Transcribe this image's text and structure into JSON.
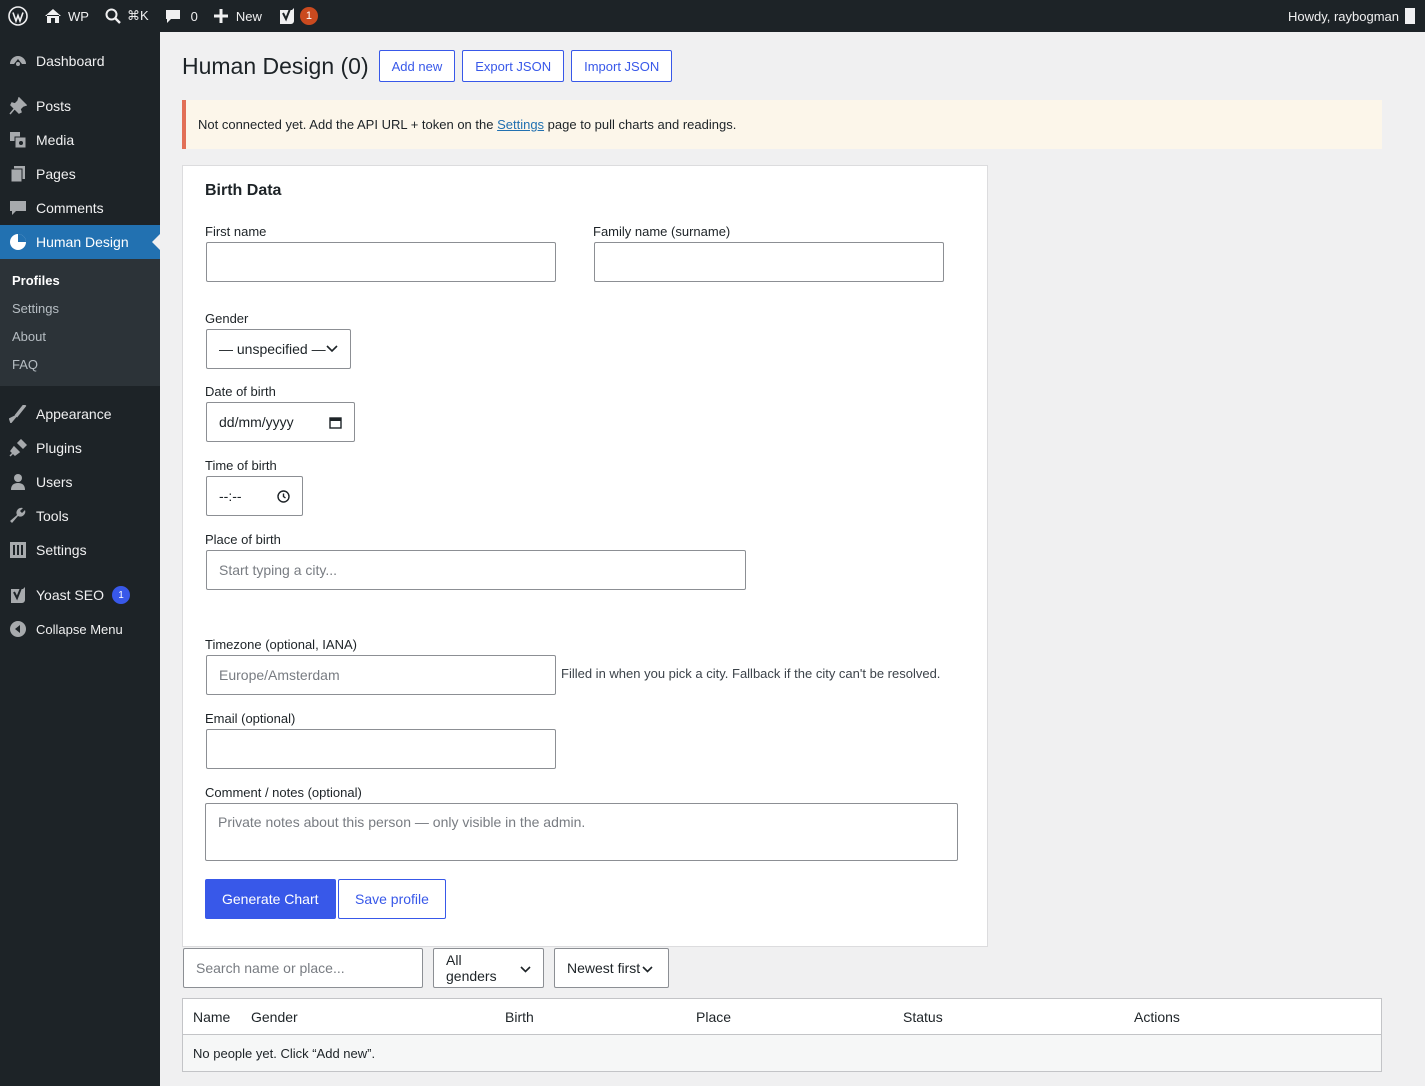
{
  "admin_bar": {
    "site_name": "WP",
    "search_shortcut": "⌘K",
    "comments_count": "0",
    "new_label": "New",
    "yoast_badge": "1",
    "greeting": "Howdy, raybogman"
  },
  "sidebar": {
    "items": [
      {
        "label": "Dashboard"
      },
      {
        "label": "Posts"
      },
      {
        "label": "Media"
      },
      {
        "label": "Pages"
      },
      {
        "label": "Comments"
      },
      {
        "label": "Human Design"
      },
      {
        "label": "Appearance"
      },
      {
        "label": "Plugins"
      },
      {
        "label": "Users"
      },
      {
        "label": "Tools"
      },
      {
        "label": "Settings"
      },
      {
        "label": "Yoast SEO",
        "badge": "1"
      },
      {
        "label": "Collapse Menu"
      }
    ],
    "submenu": [
      {
        "label": "Profiles"
      },
      {
        "label": "Settings"
      },
      {
        "label": "About"
      },
      {
        "label": "FAQ"
      }
    ]
  },
  "page": {
    "title": "Human Design (0)",
    "buttons": {
      "add_new": "Add new",
      "export_json": "Export JSON",
      "import_json": "Import JSON"
    },
    "notice": {
      "before": "Not connected yet. Add the API URL + token on the ",
      "link": "Settings",
      "after": " page to pull charts and readings."
    }
  },
  "form": {
    "heading": "Birth Data",
    "first_name": {
      "label": "First name",
      "value": ""
    },
    "family_name": {
      "label": "Family name (surname)",
      "value": ""
    },
    "gender": {
      "label": "Gender",
      "value": "— unspecified —"
    },
    "dob": {
      "label": "Date of birth",
      "value": "dd/mm/yyyy"
    },
    "tob": {
      "label": "Time of birth",
      "value": "--:--"
    },
    "place": {
      "label": "Place of birth",
      "placeholder": "Start typing a city..."
    },
    "timezone": {
      "label": "Timezone (optional, IANA)",
      "placeholder": "Europe/Amsterdam",
      "help": "Filled in when you pick a city. Fallback if the city can't be resolved."
    },
    "email": {
      "label": "Email (optional)",
      "value": ""
    },
    "comment": {
      "label": "Comment / notes (optional)",
      "placeholder": "Private notes about this person — only visible in the admin."
    },
    "generate_button": "Generate Chart",
    "save_button": "Save profile"
  },
  "list": {
    "search_placeholder": "Search name or place...",
    "gender_filter": "All genders",
    "sort": "Newest first",
    "columns": [
      "Name",
      "Gender",
      "Birth",
      "Place",
      "Status",
      "Actions"
    ],
    "empty": "No people yet. Click “Add new”."
  }
}
